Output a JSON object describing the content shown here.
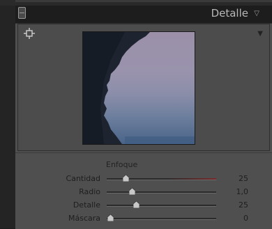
{
  "header": {
    "title": "Detalle",
    "collapse_icon": "triangle-down-icon"
  },
  "preview": {
    "tool_icon": "crosshair-target-icon",
    "menu_icon": "triangle-down-icon"
  },
  "enfoque": {
    "title": "Enfoque",
    "sliders": [
      {
        "label": "Cantidad",
        "value": "25",
        "fraction": 0.17
      },
      {
        "label": "Radio",
        "value": "1,0",
        "fraction": 0.23
      },
      {
        "label": "Detalle",
        "value": "25",
        "fraction": 0.27
      },
      {
        "label": "Máscara",
        "value": "0",
        "fraction": 0.03
      }
    ]
  },
  "colors": {
    "panel": "#4f4f4f",
    "background": "#1d1d1d",
    "slider_accent": "#7a2a2a"
  }
}
